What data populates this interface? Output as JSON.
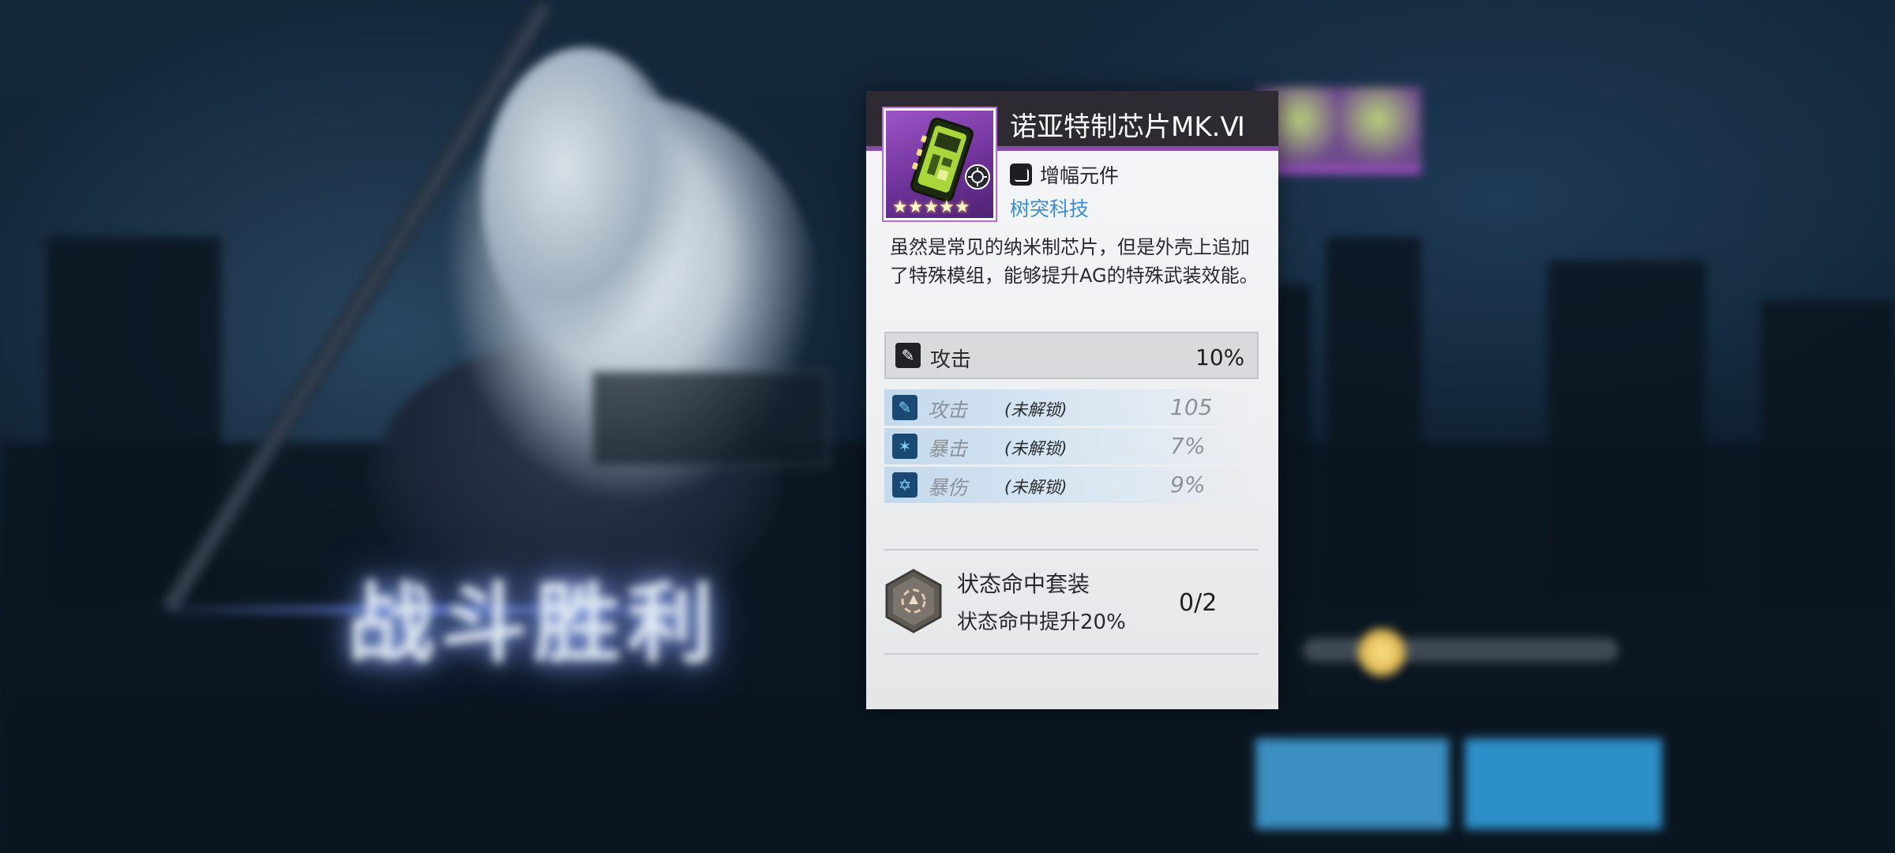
{
  "item": {
    "title": "诺亚特制芯片MK.Ⅵ",
    "type_label": "增幅元件",
    "manufacturer": "树突科技",
    "rarity_stars": "★★★★★",
    "description": "虽然是常见的纳米制芯片，但是外壳上追加了特殊模组，能够提升AG的特殊武装效能。"
  },
  "main_stat": {
    "name": "攻击",
    "value": "10%",
    "icon": "pen-icon"
  },
  "sub_stats": [
    {
      "name": "攻击",
      "lock": "(未解锁)",
      "value": "105",
      "icon": "pen-icon"
    },
    {
      "name": "暴击",
      "lock": "(未解锁)",
      "value": "7%",
      "icon": "star-burst-icon"
    },
    {
      "name": "暴伤",
      "lock": "(未解锁)",
      "value": "9%",
      "icon": "star-outline-icon"
    }
  ],
  "set_bonus": {
    "name": "状态命中套装",
    "effect": "状态命中提升20%",
    "count": "0/2"
  },
  "background": {
    "banner_text": "战斗胜利"
  },
  "colors": {
    "rarity_purple": "#8b4ca8",
    "header_dark": "#2d2a32",
    "manufacturer_blue": "#3a8fd8",
    "substat_bar": "#c3d9ec"
  }
}
